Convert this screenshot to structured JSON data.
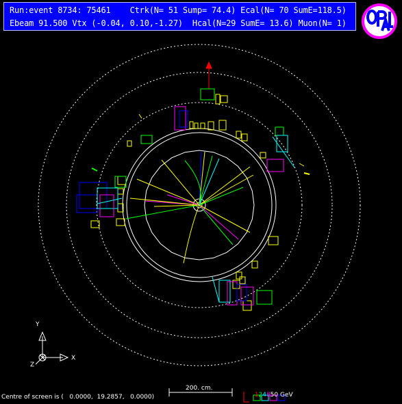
{
  "header": {
    "line1": "Run:event 8734: 75461    Ctrk(N= 51 Sump= 74.4) Ecal(N= 70 SumE=118.5)",
    "line2": "Ebeam 91.500 Vtx (-0.04, 0.10,-1.27)  Hcal(N=29 SumE= 13.6) Muon(N= 1)"
  },
  "logo": {
    "text": "OPAL",
    "colors": {
      "ring": "#ff00ff",
      "fill": "#ffffff",
      "letters": "#0000ff"
    }
  },
  "axes": {
    "y": "Y",
    "x": "X",
    "z": "Z"
  },
  "scale_bar": {
    "label": "200. cm."
  },
  "energy_scale": {
    "values": [
      "1",
      "2",
      "4",
      "8",
      "50 GeV"
    ],
    "colors": [
      "#ff0000",
      "#00ff00",
      "#00ffff",
      "#ff00ff",
      "#ffffff"
    ]
  },
  "footer": {
    "centre": "Centre of screen is (   0.0000,  19.2857,   0.0000)"
  },
  "colors": {
    "background": "#000000",
    "header": "#0000ff",
    "tracks": "#ffff00",
    "ecal": "#ffff00",
    "hcal": "#ff00ff",
    "muon": "#ff0000"
  }
}
